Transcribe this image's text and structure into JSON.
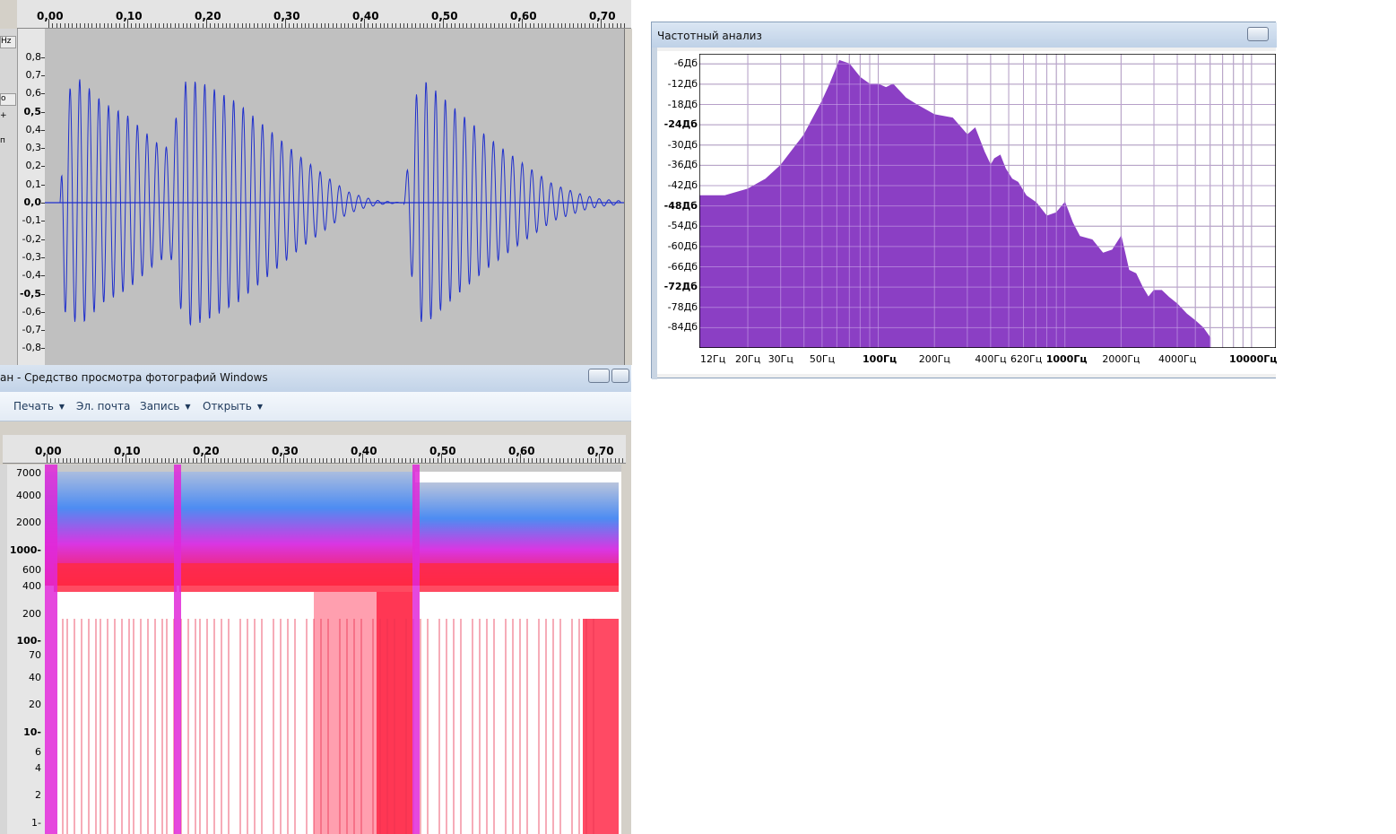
{
  "waveform": {
    "ruler_ticks": [
      "0,00",
      "0,10",
      "0,20",
      "0,30",
      "0,40",
      "0,50",
      "0,60",
      "0,70"
    ],
    "ruler_values": [
      0,
      0.1,
      0.2,
      0.3,
      0.4,
      0.5,
      0.6,
      0.7
    ],
    "amplitude_labels": [
      "0,8",
      "0,7",
      "0,6",
      "0,5",
      "0,4",
      "0,3",
      "0,2",
      "0,1",
      "0,0",
      "-0,1",
      "-0,2",
      "-0,3",
      "-0,4",
      "-0,5",
      "-0,6",
      "-0,7",
      "-0,8"
    ],
    "amplitude_values": [
      0.8,
      0.7,
      0.6,
      0.5,
      0.4,
      0.3,
      0.2,
      0.1,
      0,
      -0.1,
      -0.2,
      -0.3,
      -0.4,
      -0.5,
      -0.6,
      -0.7,
      -0.8
    ],
    "strip_labels": [
      "Hz",
      "о",
      "+",
      "п"
    ],
    "wave_color": "#1f2fcc",
    "background_color": "#c0c0c0"
  },
  "photo_viewer": {
    "title": "ан - Средство просмотра фотографий Windows",
    "toolbar": [
      {
        "label": "Печать",
        "dropdown": true
      },
      {
        "label": "Эл. почта",
        "dropdown": false
      },
      {
        "label": "Запись",
        "dropdown": true
      },
      {
        "label": "Открыть",
        "dropdown": true
      }
    ],
    "ruler_ticks": [
      "0,00",
      "0,10",
      "0,20",
      "0,30",
      "0,40",
      "0,50",
      "0,60",
      "0,70"
    ],
    "freq_labels": [
      {
        "text": "7000",
        "v": 7000,
        "bold": false
      },
      {
        "text": "4000",
        "v": 4000,
        "bold": false
      },
      {
        "text": "2000",
        "v": 2000,
        "bold": false
      },
      {
        "text": "1000-",
        "v": 1000,
        "bold": true
      },
      {
        "text": "600",
        "v": 600,
        "bold": false
      },
      {
        "text": "400",
        "v": 400,
        "bold": false
      },
      {
        "text": "200",
        "v": 200,
        "bold": false
      },
      {
        "text": "100-",
        "v": 100,
        "bold": true
      },
      {
        "text": "70",
        "v": 70,
        "bold": false
      },
      {
        "text": "40",
        "v": 40,
        "bold": false
      },
      {
        "text": "20",
        "v": 20,
        "bold": false
      },
      {
        "text": "10-",
        "v": 10,
        "bold": true
      },
      {
        "text": "6",
        "v": 6,
        "bold": false
      },
      {
        "text": "4",
        "v": 4,
        "bold": false
      },
      {
        "text": "2",
        "v": 2,
        "bold": false
      },
      {
        "text": "1-",
        "v": 1,
        "bold": false
      }
    ]
  },
  "freq_analysis": {
    "title": "Частотный анализ",
    "fill_color": "#8b3fc4",
    "db_labels": [
      {
        "text": "-6Дб",
        "v": -6,
        "bold": false
      },
      {
        "text": "-12Дб",
        "v": -12,
        "bold": false
      },
      {
        "text": "-18Дб",
        "v": -18,
        "bold": false
      },
      {
        "text": "-24Дб",
        "v": -24,
        "bold": true
      },
      {
        "text": "-30Дб",
        "v": -30,
        "bold": false
      },
      {
        "text": "-36Дб",
        "v": -36,
        "bold": false
      },
      {
        "text": "-42Дб",
        "v": -42,
        "bold": false
      },
      {
        "text": "-48Дб",
        "v": -48,
        "bold": true
      },
      {
        "text": "-54Дб",
        "v": -54,
        "bold": false
      },
      {
        "text": "-60Дб",
        "v": -60,
        "bold": false
      },
      {
        "text": "-66Дб",
        "v": -66,
        "bold": false
      },
      {
        "text": "-72Дб",
        "v": -72,
        "bold": true
      },
      {
        "text": "-78Дб",
        "v": -78,
        "bold": false
      },
      {
        "text": "-84Дб",
        "v": -84,
        "bold": false
      }
    ],
    "hz_labels": [
      {
        "text": "12Гц",
        "v": 12,
        "bold": false
      },
      {
        "text": "20Гц",
        "v": 20,
        "bold": false
      },
      {
        "text": "30Гц",
        "v": 30,
        "bold": false
      },
      {
        "text": "50Гц",
        "v": 50,
        "bold": false
      },
      {
        "text": "100Гц",
        "v": 100,
        "bold": true
      },
      {
        "text": "200Гц",
        "v": 200,
        "bold": false
      },
      {
        "text": "400Гц",
        "v": 400,
        "bold": false
      },
      {
        "text": "620Гц",
        "v": 620,
        "bold": false
      },
      {
        "text": "1000Гц",
        "v": 1000,
        "bold": true
      },
      {
        "text": "2000Гц",
        "v": 2000,
        "bold": false
      },
      {
        "text": "4000Гц",
        "v": 4000,
        "bold": false
      },
      {
        "text": "10000Гц",
        "v": 10000,
        "bold": true
      }
    ]
  },
  "chart_data": [
    {
      "type": "line",
      "title": "",
      "xlim": [
        0,
        0.73
      ],
      "ylim": [
        -0.85,
        0.85
      ],
      "envelope": {
        "x": [
          0.015,
          0.02,
          0.04,
          0.07,
          0.1,
          0.12,
          0.14,
          0.155,
          0.165,
          0.175,
          0.2,
          0.24,
          0.28,
          0.32,
          0.36,
          0.38,
          0.4,
          0.42,
          0.45,
          0.465,
          0.475,
          0.49,
          0.52,
          0.56,
          0.6,
          0.64,
          0.68,
          0.7,
          0.725
        ],
        "y": [
          0,
          0.6,
          0.68,
          0.55,
          0.48,
          0.4,
          0.32,
          0.3,
          0.55,
          0.68,
          0.65,
          0.55,
          0.4,
          0.25,
          0.12,
          0.06,
          0.03,
          0.01,
          0.0,
          0.58,
          0.68,
          0.62,
          0.5,
          0.35,
          0.22,
          0.1,
          0.04,
          0.02,
          0.01
        ]
      }
    },
    {
      "type": "area",
      "title": "",
      "x_scale": "log",
      "xlim": [
        11,
        13500
      ],
      "ylim": [
        -90,
        -3
      ],
      "x": [
        11,
        15,
        20,
        25,
        30,
        40,
        50,
        55,
        62,
        70,
        80,
        90,
        100,
        110,
        120,
        140,
        160,
        200,
        250,
        300,
        330,
        370,
        400,
        420,
        450,
        480,
        520,
        560,
        620,
        700,
        800,
        900,
        1000,
        1100,
        1200,
        1400,
        1600,
        1800,
        2000,
        2200,
        2400,
        2600,
        2800,
        3000,
        3300,
        3600,
        4000,
        4500,
        5000,
        5500,
        6000
      ],
      "y": [
        -45,
        -45,
        -43,
        -40,
        -36,
        -27,
        -17,
        -12,
        -5,
        -6,
        -10,
        -12,
        -12,
        -13,
        -12,
        -16,
        -18,
        -21,
        -22,
        -27,
        -25,
        -32,
        -36,
        -34,
        -33,
        -37,
        -40,
        -41,
        -45,
        -47,
        -51,
        -50,
        -47,
        -53,
        -57,
        -58,
        -62,
        -61,
        -57,
        -67,
        -68,
        -72,
        -75,
        -73,
        -73,
        -75,
        -77,
        -80,
        -82,
        -84,
        -87
      ]
    }
  ]
}
